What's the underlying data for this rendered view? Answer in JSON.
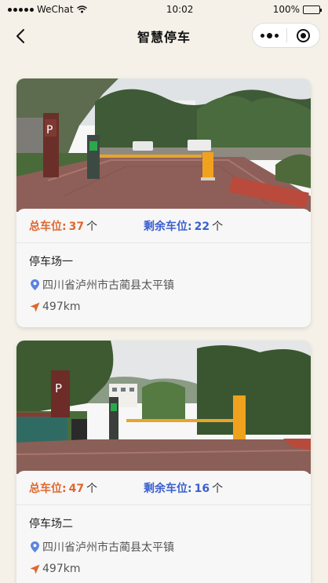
{
  "status_bar": {
    "carrier": "WeChat",
    "time": "10:02",
    "battery": "100%",
    "battery_level": 1.0
  },
  "nav": {
    "title": "智慧停车"
  },
  "colors": {
    "total": "#e0672f",
    "remaining": "#3b5fd0",
    "location_pin": "#5b84e0",
    "distance_arrow": "#e0672f"
  },
  "lots": [
    {
      "total_label": "总车位:",
      "total_value": "37",
      "total_unit": "个",
      "remain_label": "剩余车位:",
      "remain_value": "22",
      "remain_unit": "个",
      "name": "停车场一",
      "address": "四川省泸州市古蔺县太平镇",
      "distance": "497km"
    },
    {
      "total_label": "总车位:",
      "total_value": "47",
      "total_unit": "个",
      "remain_label": "剩余车位:",
      "remain_value": "16",
      "remain_unit": "个",
      "name": "停车场二",
      "address": "四川省泸州市古蔺县太平镇",
      "distance": "497km"
    }
  ]
}
